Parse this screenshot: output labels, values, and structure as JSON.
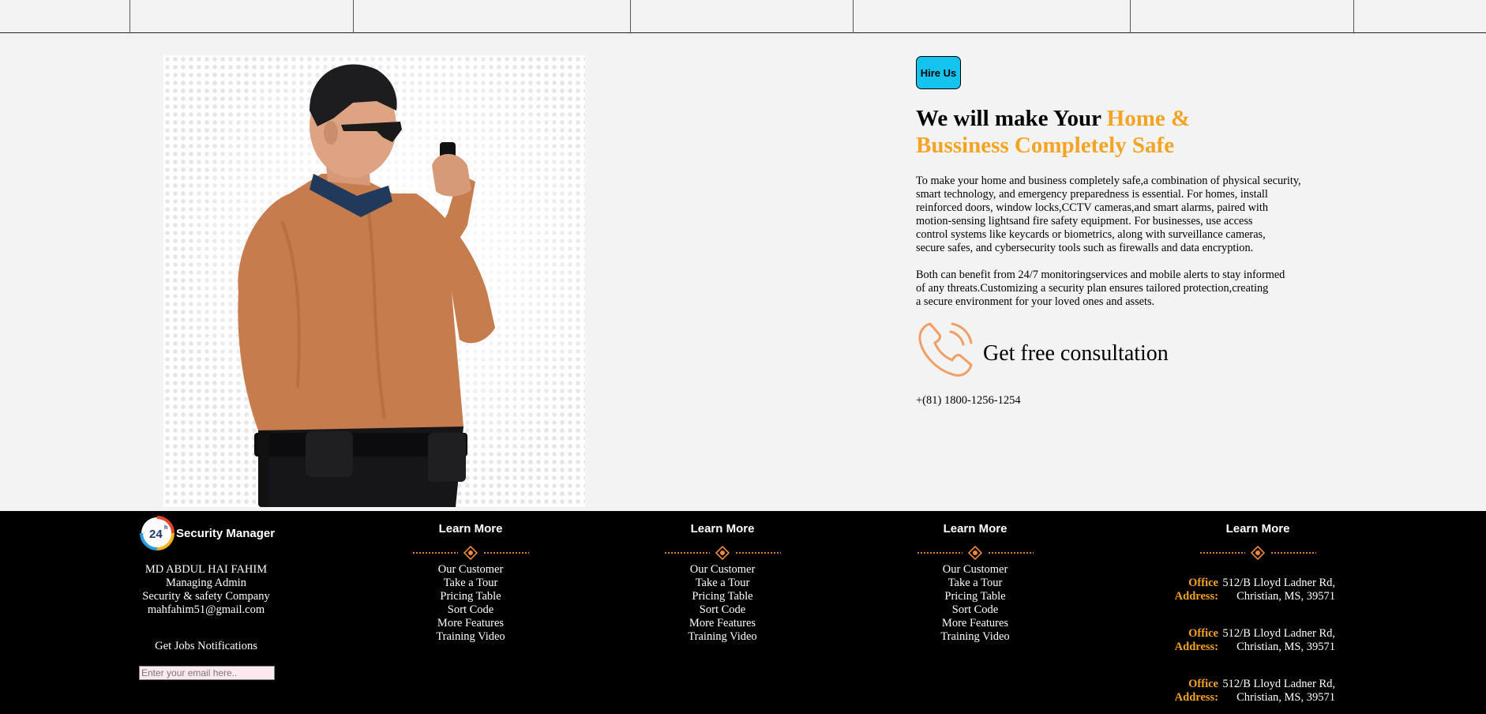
{
  "hero": {
    "hire_label": "Hire Us",
    "headline_plain": "We will make Your ",
    "headline_highlight": "Home & Bussiness Completely Safe",
    "paragraph_1": "To make your home and business completely safe,a combination of physical security,\nsmart technology, and emergency preparedness is essential. For homes, install\nreinforced doors, window locks,CCTV cameras,and smart alarms, paired with\nmotion-sensing lightsand fire safety equipment. For businesses, use access\ncontrol systems like keycards or biometrics, along with surveillance cameras,\nsecure safes, and cybersecurity tools such as firewalls and data encryption.",
    "paragraph_2": "Both can benefit from 24/7 monitoringservices and mobile alerts to stay informed\nof any threats.Customizing a security plan ensures tailored protection,creating\na secure environment for your loved ones and assets.",
    "consult_label": "Get free consultation",
    "consult_icon": "phone-icon",
    "phone": "+(81) 1800-1256-1254"
  },
  "footer": {
    "brand_name": "Security Manager",
    "brand_logo_text": "24",
    "brand_logo_sup": "h",
    "person": {
      "name": "MD ABDUL HAI FAHIM",
      "role": "Managing Admin",
      "company": "Security & safety Company",
      "email": "mahfahim51@gmail.com"
    },
    "jobs_title": "Get Jobs Notifications",
    "email_placeholder": "Enter your email here..",
    "columns": [
      {
        "title": "Learn More",
        "links": [
          "Our Customer",
          "Take a Tour",
          "Pricing Table",
          "Sort Code",
          "More Features",
          "Training Video"
        ]
      },
      {
        "title": "Learn More",
        "links": [
          "Our Customer",
          "Take a Tour",
          "Pricing Table",
          "Sort Code",
          "More Features",
          "Training Video"
        ]
      },
      {
        "title": "Learn More",
        "links": [
          "Our Customer",
          "Take a Tour",
          "Pricing Table",
          "Sort Code",
          "More Features",
          "Training Video"
        ]
      }
    ],
    "address_column": {
      "title": "Learn More",
      "entries": [
        {
          "label": "Office Address:",
          "line1": "512/B Lloyd Ladner Rd,",
          "line2": "Christian, MS, 39571"
        },
        {
          "label": "Office Address:",
          "line1": "512/B Lloyd Ladner Rd,",
          "line2": "Christian, MS, 39571"
        },
        {
          "label": "Office Address:",
          "line1": "512/B Lloyd Ladner Rd,",
          "line2": "Christian, MS, 39571"
        }
      ]
    }
  },
  "colors": {
    "accent_orange": "#f4a324",
    "hire_button": "#14c4ee",
    "footer_bg": "#000000",
    "divider_orange": "#e98a3f"
  }
}
